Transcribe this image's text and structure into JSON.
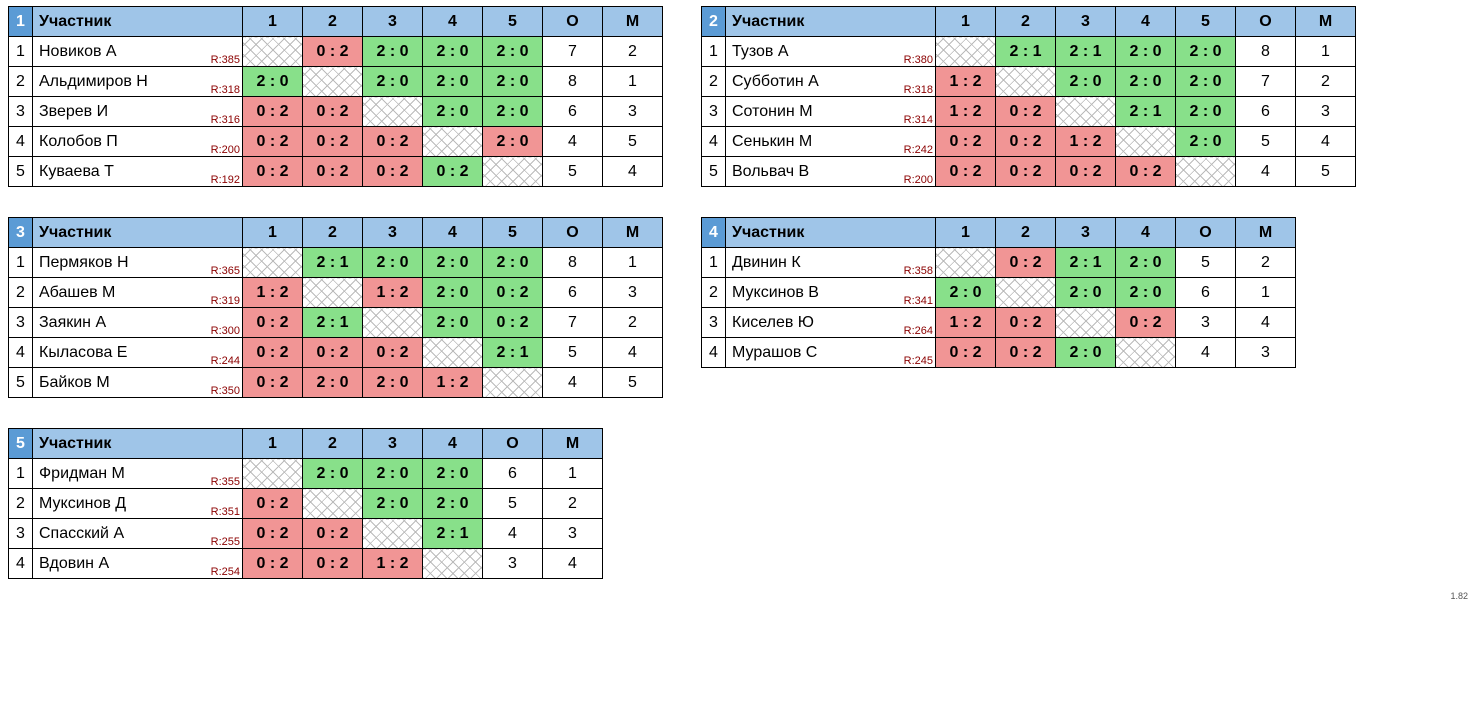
{
  "labels": {
    "participant": "Участник",
    "points": "О",
    "place": "М"
  },
  "version": "1.82",
  "groups": [
    {
      "no": 1,
      "rounds": 5,
      "players": [
        {
          "idx": 1,
          "name": "Новиков А",
          "rating": "R:385",
          "scores": [
            null,
            {
              "t": "0 : 2",
              "r": "loss"
            },
            {
              "t": "2 : 0",
              "r": "win"
            },
            {
              "t": "2 : 0",
              "r": "win"
            },
            {
              "t": "2 : 0",
              "r": "win"
            }
          ],
          "points": 7,
          "place": 2
        },
        {
          "idx": 2,
          "name": "Альдимиров Н",
          "rating": "R:318",
          "scores": [
            {
              "t": "2 : 0",
              "r": "win"
            },
            null,
            {
              "t": "2 : 0",
              "r": "win"
            },
            {
              "t": "2 : 0",
              "r": "win"
            },
            {
              "t": "2 : 0",
              "r": "win"
            }
          ],
          "points": 8,
          "place": 1
        },
        {
          "idx": 3,
          "name": "Зверев И",
          "rating": "R:316",
          "scores": [
            {
              "t": "0 : 2",
              "r": "loss"
            },
            {
              "t": "0 : 2",
              "r": "loss"
            },
            null,
            {
              "t": "2 : 0",
              "r": "win"
            },
            {
              "t": "2 : 0",
              "r": "win"
            }
          ],
          "points": 6,
          "place": 3
        },
        {
          "idx": 4,
          "name": "Колобов П",
          "rating": "R:200",
          "scores": [
            {
              "t": "0 : 2",
              "r": "loss"
            },
            {
              "t": "0 : 2",
              "r": "loss"
            },
            {
              "t": "0 : 2",
              "r": "loss"
            },
            null,
            {
              "t": "2 : 0",
              "r": "loss"
            }
          ],
          "points": 4,
          "place": 5
        },
        {
          "idx": 5,
          "name": "Куваева Т",
          "rating": "R:192",
          "scores": [
            {
              "t": "0 : 2",
              "r": "loss"
            },
            {
              "t": "0 : 2",
              "r": "loss"
            },
            {
              "t": "0 : 2",
              "r": "loss"
            },
            {
              "t": "0 : 2",
              "r": "win"
            },
            null
          ],
          "points": 5,
          "place": 4
        }
      ]
    },
    {
      "no": 2,
      "rounds": 5,
      "players": [
        {
          "idx": 1,
          "name": "Тузов А",
          "rating": "R:380",
          "scores": [
            null,
            {
              "t": "2 : 1",
              "r": "win"
            },
            {
              "t": "2 : 1",
              "r": "win"
            },
            {
              "t": "2 : 0",
              "r": "win"
            },
            {
              "t": "2 : 0",
              "r": "win"
            }
          ],
          "points": 8,
          "place": 1
        },
        {
          "idx": 2,
          "name": "Субботин А",
          "rating": "R:318",
          "scores": [
            {
              "t": "1 : 2",
              "r": "loss"
            },
            null,
            {
              "t": "2 : 0",
              "r": "win"
            },
            {
              "t": "2 : 0",
              "r": "win"
            },
            {
              "t": "2 : 0",
              "r": "win"
            }
          ],
          "points": 7,
          "place": 2
        },
        {
          "idx": 3,
          "name": "Сотонин М",
          "rating": "R:314",
          "scores": [
            {
              "t": "1 : 2",
              "r": "loss"
            },
            {
              "t": "0 : 2",
              "r": "loss"
            },
            null,
            {
              "t": "2 : 1",
              "r": "win"
            },
            {
              "t": "2 : 0",
              "r": "win"
            }
          ],
          "points": 6,
          "place": 3
        },
        {
          "idx": 4,
          "name": "Сенькин М",
          "rating": "R:242",
          "scores": [
            {
              "t": "0 : 2",
              "r": "loss"
            },
            {
              "t": "0 : 2",
              "r": "loss"
            },
            {
              "t": "1 : 2",
              "r": "loss"
            },
            null,
            {
              "t": "2 : 0",
              "r": "win"
            }
          ],
          "points": 5,
          "place": 4
        },
        {
          "idx": 5,
          "name": "Вольвач В",
          "rating": "R:200",
          "scores": [
            {
              "t": "0 : 2",
              "r": "loss"
            },
            {
              "t": "0 : 2",
              "r": "loss"
            },
            {
              "t": "0 : 2",
              "r": "loss"
            },
            {
              "t": "0 : 2",
              "r": "loss"
            },
            null
          ],
          "points": 4,
          "place": 5
        }
      ]
    },
    {
      "no": 3,
      "rounds": 5,
      "players": [
        {
          "idx": 1,
          "name": "Пермяков Н",
          "rating": "R:365",
          "scores": [
            null,
            {
              "t": "2 : 1",
              "r": "win"
            },
            {
              "t": "2 : 0",
              "r": "win"
            },
            {
              "t": "2 : 0",
              "r": "win"
            },
            {
              "t": "2 : 0",
              "r": "win"
            }
          ],
          "points": 8,
          "place": 1
        },
        {
          "idx": 2,
          "name": "Абашев М",
          "rating": "R:319",
          "scores": [
            {
              "t": "1 : 2",
              "r": "loss"
            },
            null,
            {
              "t": "1 : 2",
              "r": "loss"
            },
            {
              "t": "2 : 0",
              "r": "win"
            },
            {
              "t": "0 : 2",
              "r": "win"
            }
          ],
          "points": 6,
          "place": 3
        },
        {
          "idx": 3,
          "name": "Заякин А",
          "rating": "R:300",
          "scores": [
            {
              "t": "0 : 2",
              "r": "loss"
            },
            {
              "t": "2 : 1",
              "r": "win"
            },
            null,
            {
              "t": "2 : 0",
              "r": "win"
            },
            {
              "t": "0 : 2",
              "r": "win"
            }
          ],
          "points": 7,
          "place": 2
        },
        {
          "idx": 4,
          "name": "Кыласова Е",
          "rating": "R:244",
          "scores": [
            {
              "t": "0 : 2",
              "r": "loss"
            },
            {
              "t": "0 : 2",
              "r": "loss"
            },
            {
              "t": "0 : 2",
              "r": "loss"
            },
            null,
            {
              "t": "2 : 1",
              "r": "win"
            }
          ],
          "points": 5,
          "place": 4
        },
        {
          "idx": 5,
          "name": "Байков М",
          "rating": "R:350",
          "scores": [
            {
              "t": "0 : 2",
              "r": "loss"
            },
            {
              "t": "2 : 0",
              "r": "loss"
            },
            {
              "t": "2 : 0",
              "r": "loss"
            },
            {
              "t": "1 : 2",
              "r": "loss"
            },
            null
          ],
          "points": 4,
          "place": 5
        }
      ]
    },
    {
      "no": 4,
      "rounds": 4,
      "players": [
        {
          "idx": 1,
          "name": "Двинин К",
          "rating": "R:358",
          "scores": [
            null,
            {
              "t": "0 : 2",
              "r": "loss"
            },
            {
              "t": "2 : 1",
              "r": "win"
            },
            {
              "t": "2 : 0",
              "r": "win"
            }
          ],
          "points": 5,
          "place": 2
        },
        {
          "idx": 2,
          "name": "Муксинов В",
          "rating": "R:341",
          "scores": [
            {
              "t": "2 : 0",
              "r": "win"
            },
            null,
            {
              "t": "2 : 0",
              "r": "win"
            },
            {
              "t": "2 : 0",
              "r": "win"
            }
          ],
          "points": 6,
          "place": 1
        },
        {
          "idx": 3,
          "name": "Киселев Ю",
          "rating": "R:264",
          "scores": [
            {
              "t": "1 : 2",
              "r": "loss"
            },
            {
              "t": "0 : 2",
              "r": "loss"
            },
            null,
            {
              "t": "0 : 2",
              "r": "loss"
            }
          ],
          "points": 3,
          "place": 4
        },
        {
          "idx": 4,
          "name": "Мурашов С",
          "rating": "R:245",
          "scores": [
            {
              "t": "0 : 2",
              "r": "loss"
            },
            {
              "t": "0 : 2",
              "r": "loss"
            },
            {
              "t": "2 : 0",
              "r": "win"
            },
            null
          ],
          "points": 4,
          "place": 3
        }
      ]
    },
    {
      "no": 5,
      "rounds": 4,
      "players": [
        {
          "idx": 1,
          "name": "Фридман М",
          "rating": "R:355",
          "scores": [
            null,
            {
              "t": "2 : 0",
              "r": "win"
            },
            {
              "t": "2 : 0",
              "r": "win"
            },
            {
              "t": "2 : 0",
              "r": "win"
            }
          ],
          "points": 6,
          "place": 1
        },
        {
          "idx": 2,
          "name": "Муксинов Д",
          "rating": "R:351",
          "scores": [
            {
              "t": "0 : 2",
              "r": "loss"
            },
            null,
            {
              "t": "2 : 0",
              "r": "win"
            },
            {
              "t": "2 : 0",
              "r": "win"
            }
          ],
          "points": 5,
          "place": 2
        },
        {
          "idx": 3,
          "name": "Спасский А",
          "rating": "R:255",
          "scores": [
            {
              "t": "0 : 2",
              "r": "loss"
            },
            {
              "t": "0 : 2",
              "r": "loss"
            },
            null,
            {
              "t": "2 : 1",
              "r": "win"
            }
          ],
          "points": 4,
          "place": 3
        },
        {
          "idx": 4,
          "name": "Вдовин А",
          "rating": "R:254",
          "scores": [
            {
              "t": "0 : 2",
              "r": "loss"
            },
            {
              "t": "0 : 2",
              "r": "loss"
            },
            {
              "t": "1 : 2",
              "r": "loss"
            },
            null
          ],
          "points": 3,
          "place": 4
        }
      ]
    }
  ]
}
